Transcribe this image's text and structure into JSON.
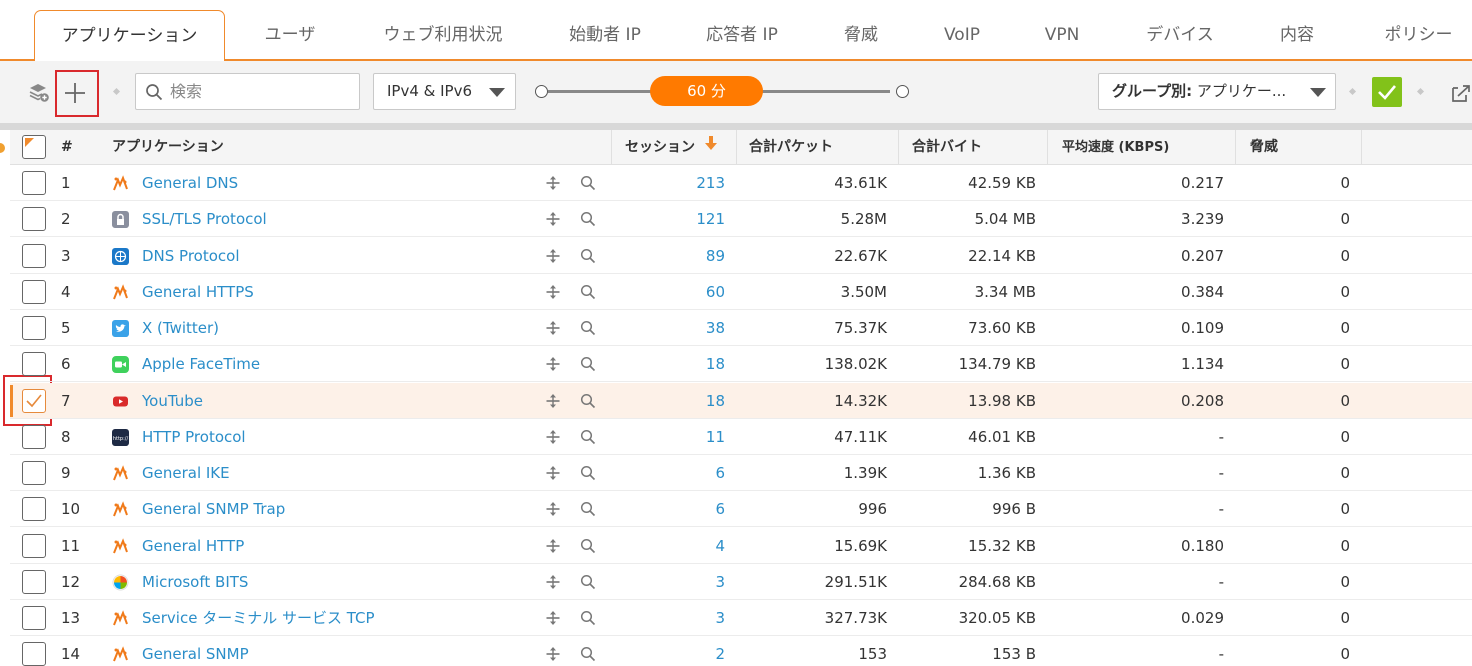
{
  "tabs": [
    {
      "label": "アプリケーション",
      "active": true
    },
    {
      "label": "ユーザ"
    },
    {
      "label": "ウェブ利用状況"
    },
    {
      "label": "始動者 IP"
    },
    {
      "label": "応答者 IP"
    },
    {
      "label": "脅威"
    },
    {
      "label": "VoIP"
    },
    {
      "label": "VPN"
    },
    {
      "label": "デバイス"
    },
    {
      "label": "内容"
    },
    {
      "label": "ポリシー"
    }
  ],
  "toolbar": {
    "search_placeholder": "検索",
    "ip_filter": "IPv4 & IPv6",
    "time_range": "60 分",
    "group_by_prefix": "グループ別:",
    "group_by_value": "アプリケー..."
  },
  "table": {
    "headers": {
      "index": "#",
      "application": "アプリケーション",
      "sessions": "セッション",
      "packets": "合計パケット",
      "bytes": "合計バイト",
      "rate": "平均速度 (KBPS)",
      "threats": "脅威"
    },
    "rows": [
      {
        "n": "1",
        "app": "General DNS",
        "icon": "sonicwall-generic",
        "sessions": "213",
        "packets": "43.61K",
        "bytes": "42.59 KB",
        "rate": "0.217",
        "threats": "0"
      },
      {
        "n": "2",
        "app": "SSL/TLS Protocol",
        "icon": "lock",
        "sessions": "121",
        "packets": "5.28M",
        "bytes": "5.04 MB",
        "rate": "3.239",
        "threats": "0"
      },
      {
        "n": "3",
        "app": "DNS Protocol",
        "icon": "globe",
        "sessions": "89",
        "packets": "22.67K",
        "bytes": "22.14 KB",
        "rate": "0.207",
        "threats": "0"
      },
      {
        "n": "4",
        "app": "General HTTPS",
        "icon": "sonicwall-generic",
        "sessions": "60",
        "packets": "3.50M",
        "bytes": "3.34 MB",
        "rate": "0.384",
        "threats": "0"
      },
      {
        "n": "5",
        "app": "X (Twitter)",
        "icon": "twitter",
        "sessions": "38",
        "packets": "75.37K",
        "bytes": "73.60 KB",
        "rate": "0.109",
        "threats": "0"
      },
      {
        "n": "6",
        "app": "Apple FaceTime",
        "icon": "facetime",
        "sessions": "18",
        "packets": "138.02K",
        "bytes": "134.79 KB",
        "rate": "1.134",
        "threats": "0"
      },
      {
        "n": "7",
        "app": "YouTube",
        "icon": "youtube",
        "sessions": "18",
        "packets": "14.32K",
        "bytes": "13.98 KB",
        "rate": "0.208",
        "threats": "0",
        "selected": true
      },
      {
        "n": "8",
        "app": "HTTP Protocol",
        "icon": "http",
        "sessions": "11",
        "packets": "47.11K",
        "bytes": "46.01 KB",
        "rate": "-",
        "threats": "0"
      },
      {
        "n": "9",
        "app": "General IKE",
        "icon": "sonicwall-generic",
        "sessions": "6",
        "packets": "1.39K",
        "bytes": "1.36 KB",
        "rate": "-",
        "threats": "0"
      },
      {
        "n": "10",
        "app": "General SNMP Trap",
        "icon": "sonicwall-generic",
        "sessions": "6",
        "packets": "996",
        "bytes": "996 B",
        "rate": "-",
        "threats": "0"
      },
      {
        "n": "11",
        "app": "General HTTP",
        "icon": "sonicwall-generic",
        "sessions": "4",
        "packets": "15.69K",
        "bytes": "15.32 KB",
        "rate": "0.180",
        "threats": "0"
      },
      {
        "n": "12",
        "app": "Microsoft BITS",
        "icon": "microsoft-bits",
        "sessions": "3",
        "packets": "291.51K",
        "bytes": "284.68 KB",
        "rate": "-",
        "threats": "0"
      },
      {
        "n": "13",
        "app": "Service ターミナル サービス TCP",
        "icon": "sonicwall-generic",
        "sessions": "3",
        "packets": "327.73K",
        "bytes": "320.05 KB",
        "rate": "0.029",
        "threats": "0"
      },
      {
        "n": "14",
        "app": "General SNMP",
        "icon": "sonicwall-generic",
        "sessions": "2",
        "packets": "153",
        "bytes": "153 B",
        "rate": "-",
        "threats": "0"
      }
    ]
  },
  "colors": {
    "accent": "#f08a2c",
    "slider": "#ff7a00",
    "link": "#2b8ec9",
    "confirm": "#82c21a",
    "highlight": "#d9292d"
  }
}
